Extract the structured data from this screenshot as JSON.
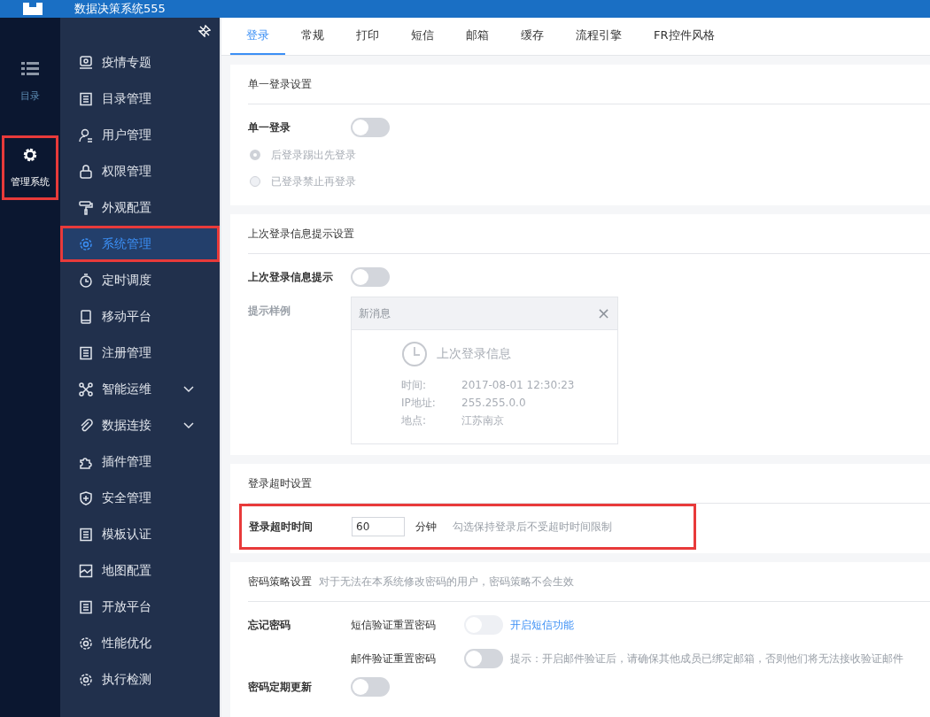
{
  "header": {
    "title": "数据决策系统555"
  },
  "rail": [
    {
      "label": "目录",
      "selected": false,
      "highlighted": false
    },
    {
      "label": "管理系统",
      "selected": true,
      "highlighted": true
    }
  ],
  "sidebar": {
    "items": [
      {
        "label": "疫情专题",
        "selected": false,
        "highlighted": false,
        "expandable": false
      },
      {
        "label": "目录管理",
        "selected": false,
        "highlighted": false,
        "expandable": false
      },
      {
        "label": "用户管理",
        "selected": false,
        "highlighted": false,
        "expandable": false
      },
      {
        "label": "权限管理",
        "selected": false,
        "highlighted": false,
        "expandable": false
      },
      {
        "label": "外观配置",
        "selected": false,
        "highlighted": false,
        "expandable": false
      },
      {
        "label": "系统管理",
        "selected": true,
        "highlighted": true,
        "expandable": false
      },
      {
        "label": "定时调度",
        "selected": false,
        "highlighted": false,
        "expandable": false
      },
      {
        "label": "移动平台",
        "selected": false,
        "highlighted": false,
        "expandable": false
      },
      {
        "label": "注册管理",
        "selected": false,
        "highlighted": false,
        "expandable": false
      },
      {
        "label": "智能运维",
        "selected": false,
        "highlighted": false,
        "expandable": true
      },
      {
        "label": "数据连接",
        "selected": false,
        "highlighted": false,
        "expandable": true
      },
      {
        "label": "插件管理",
        "selected": false,
        "highlighted": false,
        "expandable": false
      },
      {
        "label": "安全管理",
        "selected": false,
        "highlighted": false,
        "expandable": false
      },
      {
        "label": "模板认证",
        "selected": false,
        "highlighted": false,
        "expandable": false
      },
      {
        "label": "地图配置",
        "selected": false,
        "highlighted": false,
        "expandable": false
      },
      {
        "label": "开放平台",
        "selected": false,
        "highlighted": false,
        "expandable": false
      },
      {
        "label": "性能优化",
        "selected": false,
        "highlighted": false,
        "expandable": false
      },
      {
        "label": "执行检测",
        "selected": false,
        "highlighted": false,
        "expandable": false
      }
    ]
  },
  "tabs": [
    {
      "label": "登录",
      "selected": true
    },
    {
      "label": "常规",
      "selected": false
    },
    {
      "label": "打印",
      "selected": false
    },
    {
      "label": "短信",
      "selected": false
    },
    {
      "label": "邮箱",
      "selected": false
    },
    {
      "label": "缓存",
      "selected": false
    },
    {
      "label": "流程引擎",
      "selected": false
    },
    {
      "label": "FR控件风格",
      "selected": false
    }
  ],
  "single_login": {
    "title": "单一登录设置",
    "label": "单一登录",
    "on": false,
    "options": [
      {
        "label": "后登录踢出先登录",
        "selected": true,
        "disabled": true
      },
      {
        "label": "已登录禁止再登录",
        "selected": false,
        "disabled": true
      }
    ]
  },
  "last_login": {
    "title": "上次登录信息提示设置",
    "label": "上次登录信息提示",
    "on": false,
    "sample_label": "提示样例",
    "sample": {
      "header": "新消息",
      "close": "×",
      "heading": "上次登录信息",
      "rows": [
        {
          "key": "时间:",
          "value": "2017-08-01 12:30:23"
        },
        {
          "key": "IP地址:",
          "value": "255.255.0.0"
        },
        {
          "key": "地点:",
          "value": "江苏南京"
        }
      ]
    }
  },
  "timeout": {
    "title": "登录超时设置",
    "label": "登录超时时间",
    "value": "60",
    "unit": "分钟",
    "hint": "勾选保持登录后不受超时时间限制",
    "highlighted": true
  },
  "password": {
    "title": "密码策略设置",
    "note": "对于无法在本系统修改密码的用户，密码策略不会生效",
    "forgot_label": "忘记密码",
    "forgot_options": [
      {
        "label": "短信验证重置密码",
        "on": false,
        "disabled": true,
        "link": "开启短信功能"
      },
      {
        "label": "邮件验证重置密码",
        "on": false,
        "disabled": false,
        "hint": "提示：开启邮件验证后，请确保其他成员已绑定邮箱，否则他们将无法接收验证邮件"
      }
    ],
    "renew_label": "密码定期更新",
    "renew_on": false
  }
}
